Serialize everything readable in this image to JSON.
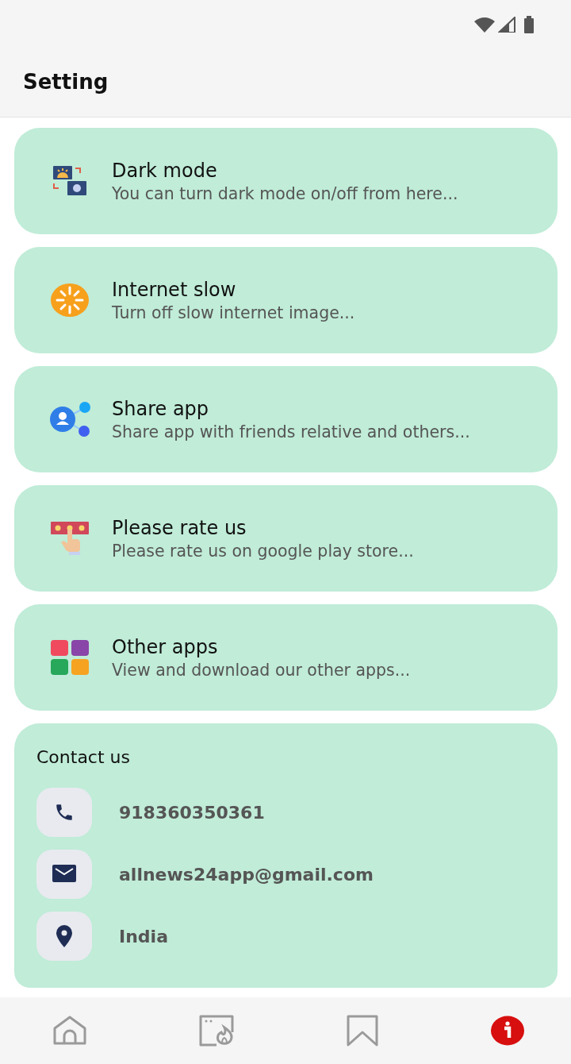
{
  "header": {
    "title": "Setting"
  },
  "settings": [
    {
      "kind": "dark",
      "title": "Dark mode",
      "subtitle": "You can turn dark mode on/off from here..."
    },
    {
      "kind": "internet",
      "title": "Internet slow",
      "subtitle": "Turn off slow internet image..."
    },
    {
      "kind": "share",
      "title": "Share app",
      "subtitle": "Share app with friends relative and others..."
    },
    {
      "kind": "rate",
      "title": "Please rate us",
      "subtitle": "Please rate us on google play store..."
    },
    {
      "kind": "apps",
      "title": "Other apps",
      "subtitle": "View and download our other apps..."
    }
  ],
  "contact": {
    "title": "Contact us",
    "items": [
      {
        "kind": "phone",
        "text": "918360350361"
      },
      {
        "kind": "email",
        "text": "allnews24app@gmail.com"
      },
      {
        "kind": "location",
        "text": "India"
      }
    ]
  },
  "bottom_nav": [
    {
      "kind": "home",
      "selected": false
    },
    {
      "kind": "trending",
      "selected": false
    },
    {
      "kind": "bookmark",
      "selected": false
    },
    {
      "kind": "info",
      "selected": true
    }
  ]
}
